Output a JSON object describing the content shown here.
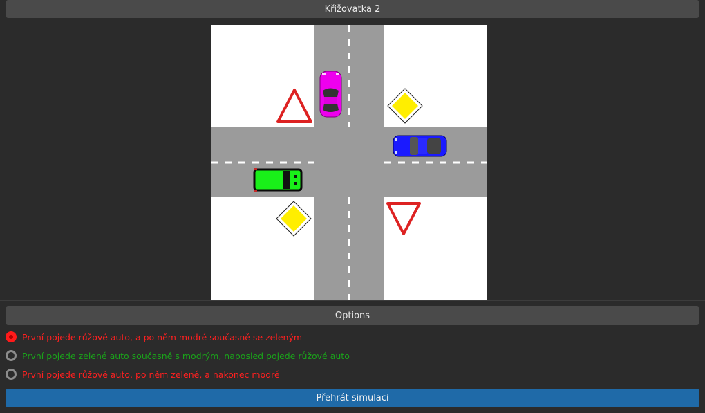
{
  "header": {
    "title": "Křižovatka 2"
  },
  "scene": {
    "background": "#ffffff",
    "road_color": "#9b9b9b",
    "cars": [
      {
        "name": "pink-car",
        "color": "#ee00ee"
      },
      {
        "name": "blue-car",
        "color": "#1a1aff"
      },
      {
        "name": "green-car",
        "color": "#19f019"
      }
    ],
    "signs": [
      "give-way-sign-north-west",
      "priority-road-sign-north-east",
      "priority-road-sign-south-west",
      "give-way-sign-south-east"
    ]
  },
  "options": {
    "title": "Options",
    "items": [
      {
        "label": "První pojede růžové auto, a po něm modré současně se zeleným",
        "color": "#ff2020",
        "selected": true
      },
      {
        "label": "První pojede zelené auto současně s modrým, naposled pojede růžové auto",
        "color": "#1aa31a",
        "selected": false
      },
      {
        "label": "První pojede růžové auto, po něm zelené, a nakonec modré",
        "color": "#ff2020",
        "selected": false
      }
    ]
  },
  "actions": {
    "play_label": "Přehrát simulaci"
  }
}
